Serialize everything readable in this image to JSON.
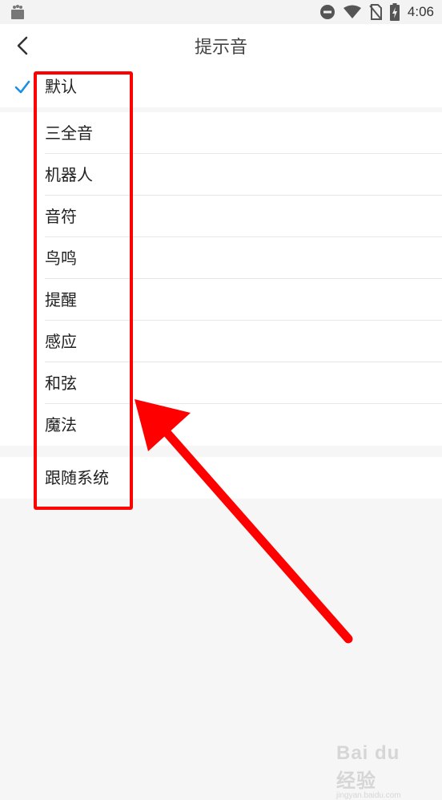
{
  "status_bar": {
    "time": "4:06",
    "icons": [
      "app-store-icon",
      "do-not-disturb-icon",
      "wifi-icon",
      "no-sim-icon",
      "battery-charging-icon"
    ]
  },
  "header": {
    "title": "提示音",
    "back_icon": "chevron-left-icon"
  },
  "sound_list": {
    "selected": "默认",
    "group_default": [
      {
        "label": "默认",
        "checked": true
      }
    ],
    "group_tones": [
      {
        "label": "三全音"
      },
      {
        "label": "机器人"
      },
      {
        "label": "音符"
      },
      {
        "label": "鸟鸣"
      },
      {
        "label": "提醒"
      },
      {
        "label": "感应"
      },
      {
        "label": "和弦"
      },
      {
        "label": "魔法"
      }
    ],
    "group_system": [
      {
        "label": "跟随系统"
      }
    ]
  },
  "colors": {
    "accent_check": "#1a8fe3",
    "annotation_red": "#ff0000",
    "background": "#f6f6f6"
  },
  "watermark": {
    "main": "Bai du 经验",
    "sub": "jingyan.baidu.com"
  }
}
